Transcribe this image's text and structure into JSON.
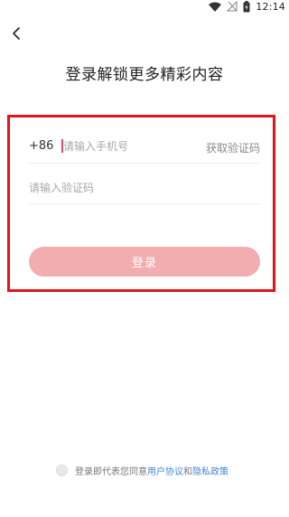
{
  "status_bar": {
    "time": "12:14",
    "icons": [
      "wifi-icon",
      "signal-icon",
      "battery-icon"
    ]
  },
  "nav": {
    "back_icon": "chevron-left-icon"
  },
  "title": "登录解锁更多精彩内容",
  "form": {
    "country_code": "+86",
    "phone_placeholder": "请输入手机号",
    "phone_value": "",
    "get_code_label": "获取验证码",
    "code_placeholder": "请输入验证码",
    "code_value": "",
    "login_label": "登录"
  },
  "agreement": {
    "prefix": "登录即代表您同意",
    "user_agreement": "用户协议",
    "and": "和",
    "privacy_policy": "隐私政策",
    "checked": false
  },
  "colors": {
    "highlight": "#e0161d",
    "login_button": "#f2adb0",
    "link": "#3f86d8",
    "caret": "#d84a7a"
  }
}
